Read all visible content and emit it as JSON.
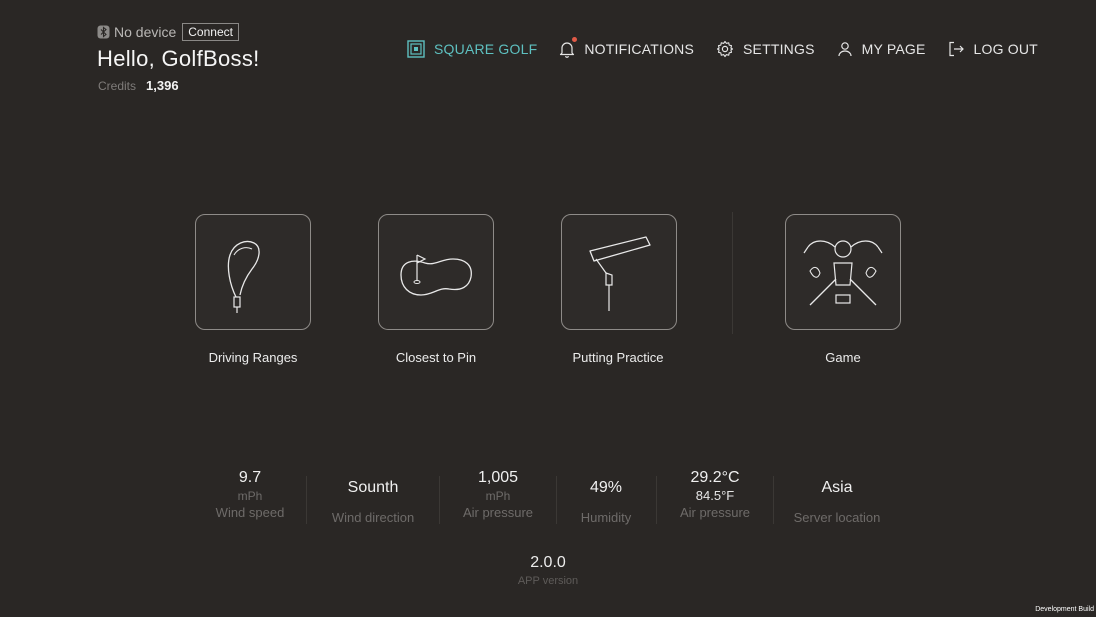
{
  "header": {
    "device_status": "No device",
    "connect_label": "Connect",
    "greeting": "Hello, GolfBoss!",
    "credits_label": "Credits",
    "credits_value": "1,396"
  },
  "nav": {
    "items": [
      {
        "label": "SQUARE GOLF",
        "icon": "square-golf-logo-icon"
      },
      {
        "label": "NOTIFICATIONS",
        "icon": "bell-icon"
      },
      {
        "label": "SETTINGS",
        "icon": "gear-icon"
      },
      {
        "label": "MY PAGE",
        "icon": "user-icon"
      },
      {
        "label": "LOG OUT",
        "icon": "logout-icon"
      }
    ]
  },
  "menu": {
    "tiles": [
      {
        "label": "Driving Ranges",
        "icon": "driver-club-icon"
      },
      {
        "label": "Closest to Pin",
        "icon": "green-flag-icon"
      },
      {
        "label": "Putting Practice",
        "icon": "putter-icon"
      },
      {
        "label": "Game",
        "icon": "trophy-crest-icon"
      }
    ]
  },
  "stats": {
    "wind_speed": {
      "value": "9.7",
      "unit": "mPh",
      "label": "Wind speed"
    },
    "wind_direction": {
      "value": "Sounth",
      "label": "Wind direction"
    },
    "air_pressure": {
      "value": "1,005",
      "unit": "mPh",
      "label": "Air pressure"
    },
    "humidity": {
      "value": "49%",
      "label": "Humidity"
    },
    "temperature": {
      "value": "29.2°C",
      "value2": "84.5°F",
      "label": "Air pressure"
    },
    "server": {
      "value": "Asia",
      "label": "Server location"
    }
  },
  "version": {
    "value": "2.0.0",
    "label": "APP version"
  },
  "footer": {
    "build_label": "Development Build"
  },
  "colors": {
    "background": "#2a2725",
    "accent": "#5ec0c0",
    "notification_dot": "#e05a47",
    "text": "#ededed",
    "muted_text": "#6e6b69"
  }
}
